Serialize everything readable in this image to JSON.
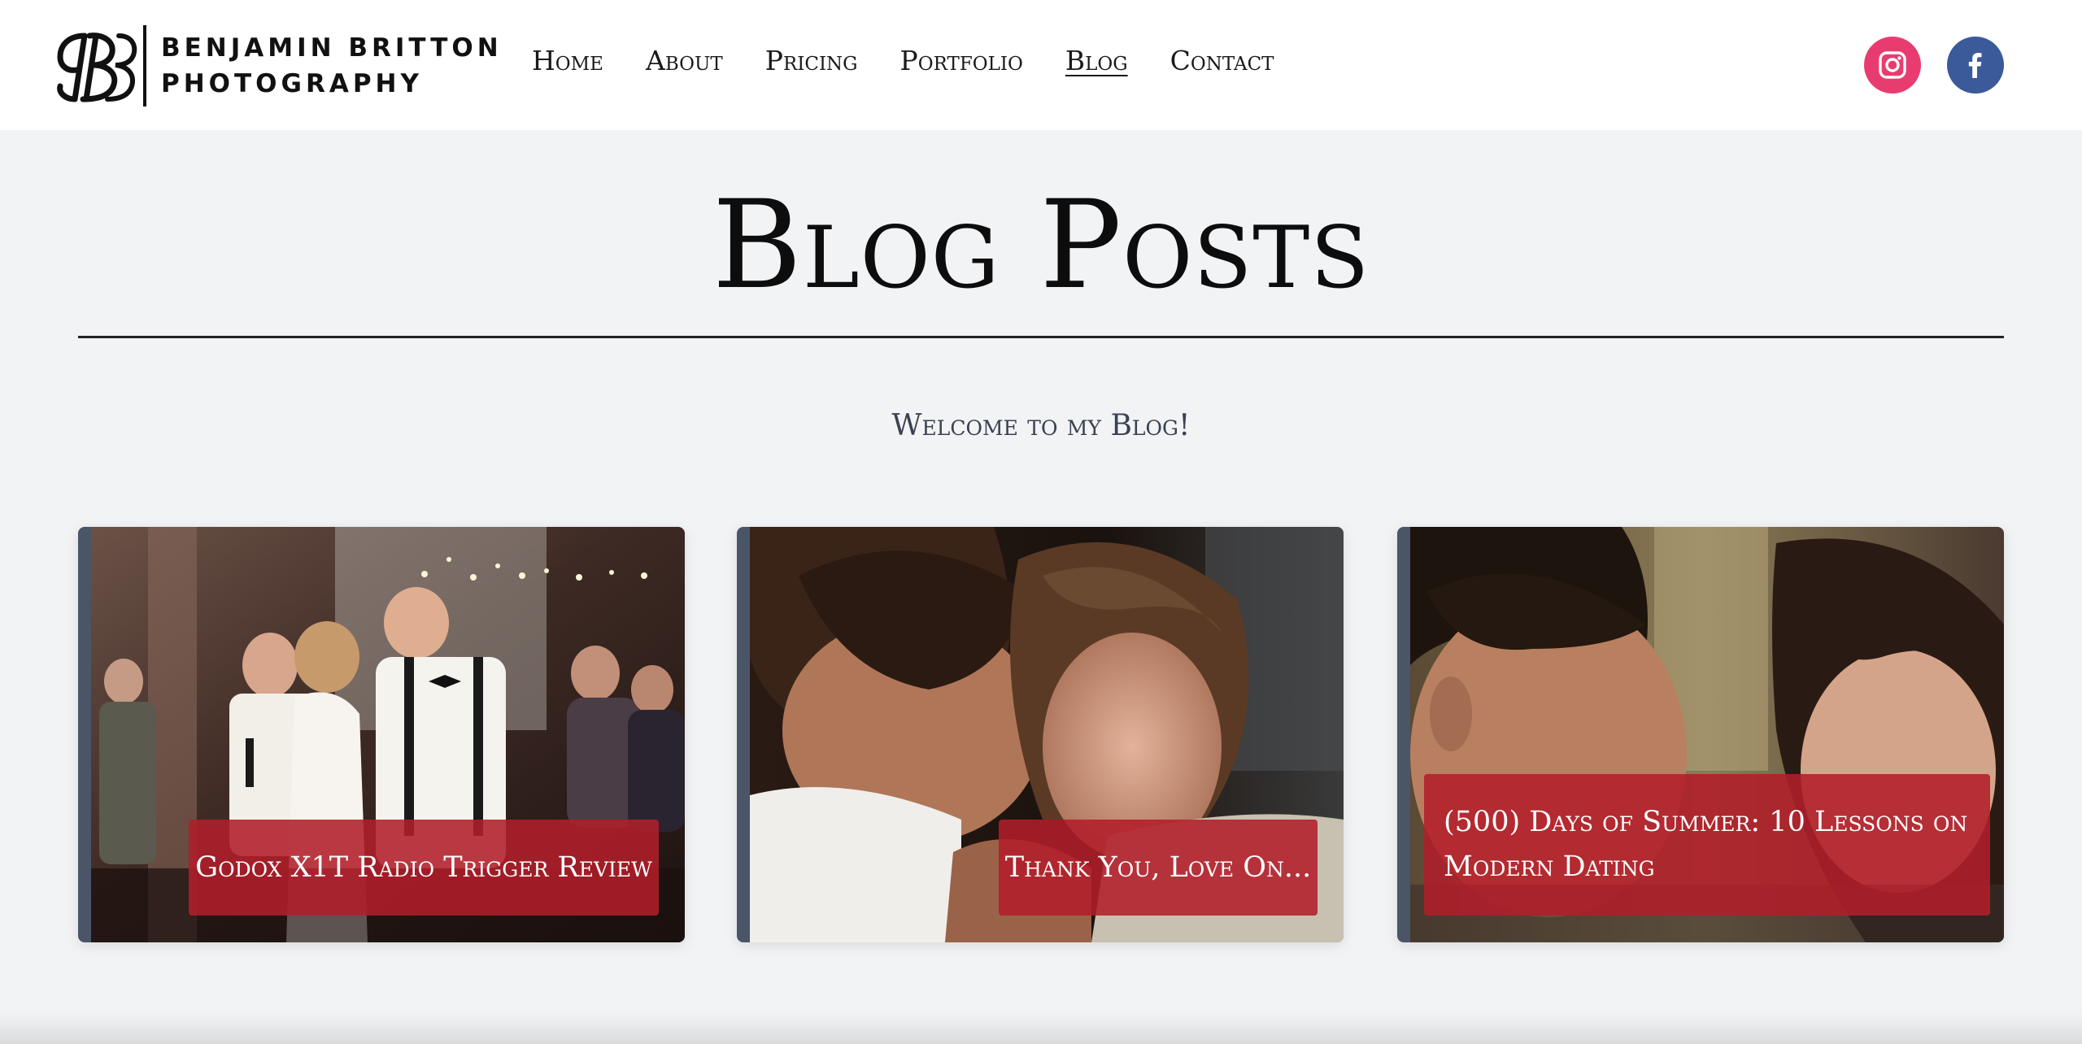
{
  "header": {
    "logo": {
      "monogram": "BB",
      "line1": "BENJAMIN BRITTON",
      "line2": "PHOTOGRAPHY"
    },
    "nav": [
      {
        "label": "Home",
        "active": false
      },
      {
        "label": "About",
        "active": false
      },
      {
        "label": "Pricing",
        "active": false
      },
      {
        "label": "Portfolio",
        "active": false
      },
      {
        "label": "Blog",
        "active": true
      },
      {
        "label": "Contact",
        "active": false
      }
    ],
    "social": [
      {
        "name": "instagram",
        "icon": "instagram-icon",
        "color": "#e83c70"
      },
      {
        "name": "facebook",
        "icon": "facebook-icon",
        "color": "#3b5a9a"
      }
    ]
  },
  "page": {
    "title": "Blog Posts",
    "subtitle": "Welcome to my Blog!"
  },
  "posts": [
    {
      "title": "Godox X1T Radio Trigger Review",
      "image": "wedding-cake-kiss-photo"
    },
    {
      "title": "Thank You, Love On...",
      "image": "couple-embrace-photo"
    },
    {
      "title": "(500) Days of Summer: 10 Lessons on Modern Dating",
      "image": "film-still-couple-photo"
    }
  ],
  "colors": {
    "background": "#f2f3f5",
    "header": "#ffffff",
    "caption": "#b21e2a",
    "card_border": "#4a5568",
    "subtitle": "#3a4150"
  }
}
